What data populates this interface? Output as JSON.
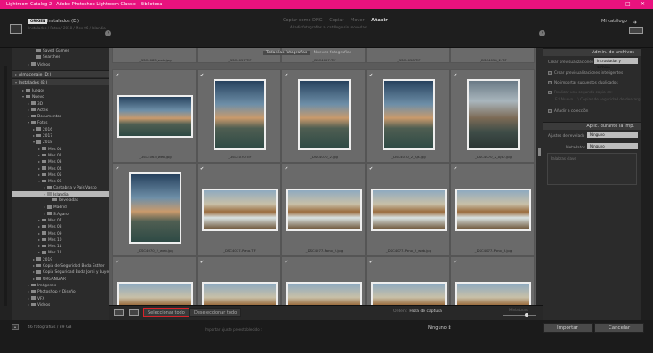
{
  "app": {
    "title": "Lightroom Catalog-2 - Adobe Photoshop Lightroom Classic - Biblioteca"
  },
  "window_controls": [
    "–",
    "□",
    "✕"
  ],
  "source": {
    "badge": "ORIGEN",
    "name": "Instalados (E:)",
    "path": "Instalados / Fotos / 2018 / Mes 06 / Islandia"
  },
  "import_modes": {
    "items": [
      "Copiar como DNG",
      "Copiar",
      "Mover",
      "Añadir"
    ],
    "active_index": 3,
    "subtitle": "Añadir fotografías al catálogo sin moverlas"
  },
  "destination": {
    "name": "Mi catálogo"
  },
  "left_panel": {
    "tree_top": [
      {
        "label": "Saved Games",
        "depth": 4,
        "twisty": ""
      },
      {
        "label": "Searches",
        "depth": 4,
        "twisty": ""
      },
      {
        "label": "Videos",
        "depth": 3,
        "twisty": "▸"
      }
    ],
    "volumes": [
      {
        "label": "Almacenaje (D:)",
        "twisty": "▸"
      },
      {
        "label": "Instalados (E:)",
        "twisty": "▾"
      }
    ],
    "tree": [
      {
        "label": "Juegos",
        "depth": 2,
        "twisty": "▸",
        "selected": false
      },
      {
        "label": "Nuevo",
        "depth": 2,
        "twisty": "▾",
        "selected": false
      },
      {
        "label": "3D",
        "depth": 3,
        "twisty": "▸",
        "selected": false
      },
      {
        "label": "Actex",
        "depth": 3,
        "twisty": "▸",
        "selected": false
      },
      {
        "label": "Documentos",
        "depth": 3,
        "twisty": "▸",
        "selected": false
      },
      {
        "label": "Fotos",
        "depth": 3,
        "twisty": "▾",
        "selected": false
      },
      {
        "label": "2016",
        "depth": 4,
        "twisty": "▸",
        "selected": false
      },
      {
        "label": "2017",
        "depth": 4,
        "twisty": "▸",
        "selected": false
      },
      {
        "label": "2018",
        "depth": 4,
        "twisty": "▾",
        "selected": false
      },
      {
        "label": "Mes 01",
        "depth": 5,
        "twisty": "▸",
        "selected": false
      },
      {
        "label": "Mes 02",
        "depth": 5,
        "twisty": "▸",
        "selected": false
      },
      {
        "label": "Mes 03",
        "depth": 5,
        "twisty": "▸",
        "selected": false
      },
      {
        "label": "Mes 04",
        "depth": 5,
        "twisty": "▸",
        "selected": false
      },
      {
        "label": "Mes 05",
        "depth": 5,
        "twisty": "▸",
        "selected": false
      },
      {
        "label": "Mes 06",
        "depth": 5,
        "twisty": "▾",
        "selected": false
      },
      {
        "label": "Cantabria y País Vasco",
        "depth": 6,
        "twisty": "▸",
        "selected": false
      },
      {
        "label": "Islandia",
        "depth": 6,
        "twisty": "▾",
        "selected": true
      },
      {
        "label": "Reveladas",
        "depth": 7,
        "twisty": "",
        "selected": false
      },
      {
        "label": "Madrid",
        "depth": 6,
        "twisty": "▸",
        "selected": false
      },
      {
        "label": "S.Agaro",
        "depth": 6,
        "twisty": "▸",
        "selected": false
      },
      {
        "label": "Mes 07",
        "depth": 5,
        "twisty": "▸",
        "selected": false
      },
      {
        "label": "Mes 08",
        "depth": 5,
        "twisty": "▸",
        "selected": false
      },
      {
        "label": "Mes 09",
        "depth": 5,
        "twisty": "▸",
        "selected": false
      },
      {
        "label": "Mes 10",
        "depth": 5,
        "twisty": "▸",
        "selected": false
      },
      {
        "label": "Mes 11",
        "depth": 5,
        "twisty": "▸",
        "selected": false
      },
      {
        "label": "Mes 12",
        "depth": 5,
        "twisty": "▸",
        "selected": false
      },
      {
        "label": "2019",
        "depth": 4,
        "twisty": "▸",
        "selected": false
      },
      {
        "label": "Copia de Seguridad Boda Esther",
        "depth": 4,
        "twisty": "▸",
        "selected": false
      },
      {
        "label": "Copia Seguridad Boda Jordi y Luyen",
        "depth": 4,
        "twisty": "▸",
        "selected": false
      },
      {
        "label": "ORGANIZAR",
        "depth": 4,
        "twisty": "▸",
        "selected": false
      },
      {
        "label": "Imágenes",
        "depth": 3,
        "twisty": "▸",
        "selected": false
      },
      {
        "label": "Photoshop y Diseño",
        "depth": 3,
        "twisty": "▸",
        "selected": false
      },
      {
        "label": "VFX",
        "depth": 3,
        "twisty": "▸",
        "selected": false
      },
      {
        "label": "Videos",
        "depth": 3,
        "twisty": "▸",
        "selected": false
      }
    ]
  },
  "grid": {
    "tabs": [
      "Todas las fotografías",
      "Nuevas fotografías"
    ],
    "active_tab": 0,
    "top_partial_names": [
      "_DSC4085_web.jpg",
      "_DSC4057.TIF",
      "_DSC4057.TIF",
      "_DSC4058.TIF",
      "_DSC4058_2.TIF"
    ],
    "cells": [
      {
        "name": "_DSC4063_web.jpg",
        "checked": true,
        "orient": "landscape",
        "style": "sky"
      },
      {
        "name": "_DSC4070.TIF",
        "checked": true,
        "orient": "portrait",
        "style": "sky"
      },
      {
        "name": "_DSC4070_2.jpg",
        "checked": true,
        "orient": "portrait",
        "style": "sky"
      },
      {
        "name": "_DSC4070_2_Ajs.jpg",
        "checked": true,
        "orient": "portrait",
        "style": "sky"
      },
      {
        "name": "_DSC4070_2_Ajs2.jpg",
        "checked": true,
        "orient": "portrait",
        "style": "sky2"
      },
      {
        "name": "_DSC4070_2_web.jpg",
        "checked": true,
        "orient": "portrait",
        "style": "sky"
      },
      {
        "name": "_DSC4077-Pano.TIF",
        "checked": true,
        "orient": "landscape",
        "style": "pano"
      },
      {
        "name": "_DSC4077-Pano_2.jpg",
        "checked": true,
        "orient": "landscape",
        "style": "pano"
      },
      {
        "name": "_DSC4077-Pano_2_web.jpg",
        "checked": true,
        "orient": "landscape",
        "style": "pano"
      },
      {
        "name": "_DSC4077-Pano_3.jpg",
        "checked": true,
        "orient": "landscape",
        "style": "pano"
      },
      {
        "name": "",
        "checked": true,
        "orient": "landscape",
        "style": "pano"
      },
      {
        "name": "",
        "checked": true,
        "orient": "landscape",
        "style": "pano"
      },
      {
        "name": "",
        "checked": true,
        "orient": "landscape",
        "style": "pano"
      },
      {
        "name": "",
        "checked": true,
        "orient": "landscape",
        "style": "pano"
      },
      {
        "name": "",
        "checked": true,
        "orient": "landscape",
        "style": "pano"
      }
    ]
  },
  "toolbar": {
    "select_all": "Seleccionar todo",
    "deselect_all": "Deseleccionar todo",
    "sort_label": "Orden:",
    "sort_value": "Hora de captura",
    "thumbs_label": "Miniaturas",
    "thumb_size": 0.72
  },
  "right_panel": {
    "file_handling_title": "Admin. de archivos",
    "build_previews_label": "Crear previsualizaciones",
    "build_previews_value": "Incrustadas y archivo...",
    "options": [
      {
        "label": "Crear previsualizaciones inteligentes",
        "checked": false,
        "dim": false
      },
      {
        "label": "No importar supuestos duplicados",
        "checked": false,
        "dim": false
      },
      {
        "label": "Realizar una segunda copia en:",
        "checked": false,
        "dim": true
      },
      {
        "label": "E:\\ Nuevo ...\\ Copias de seguridad de descarga",
        "checked": false,
        "dim": true
      },
      {
        "label": "Añadir a colección",
        "checked": false,
        "dim": false
      }
    ],
    "apply_title": "Aplic. durante la imp.",
    "develop_label": "Ajustes de revelado",
    "develop_value": "Ninguno",
    "metadata_label": "Metadatos",
    "metadata_value": "Ninguno",
    "keywords_label": "Palabras clave"
  },
  "bottom": {
    "count": "46 fotografías / 39 GB",
    "preset_label": "Importar ajuste preestablecido :",
    "preset_value": "Ninguno ⇕",
    "import_button": "Importar",
    "cancel_button": "Cancelar"
  },
  "colors": {
    "titlebar": "#e8127e",
    "highlight_border": "#d8232a"
  }
}
